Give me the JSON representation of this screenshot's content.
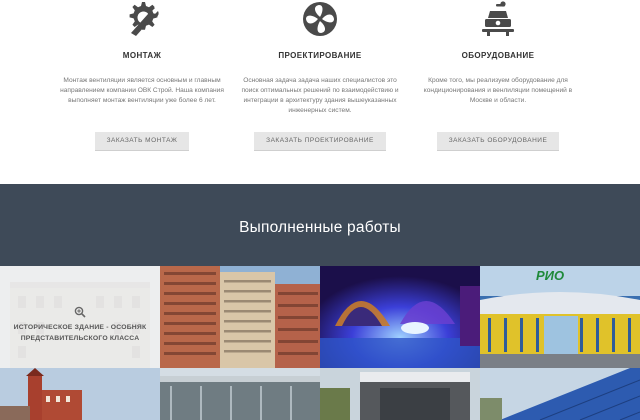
{
  "services": [
    {
      "icon": "wrench-gear-icon",
      "title": "МОНТАЖ",
      "description": "Монтаж вентиляции является основным и главным направлением компании ОВК Строй. Наша компания выполняет монтаж вентиляции уже более 6 лет.",
      "button": "ЗАКАЗАТЬ МОНТАЖ"
    },
    {
      "icon": "fan-icon",
      "title": "ПРОЕКТИРОВАНИЕ",
      "description": "Основная задача задача наших специалистов это поиск оптимальных решений по взаимодействию и интеграции в архитектуру здания вышеуказанных инженерных систем.",
      "button": "ЗАКАЗАТЬ ПРОЕКТИРОВАНИЕ"
    },
    {
      "icon": "projector-equipment-icon",
      "title": "ОБОРУДОВАНИЕ",
      "description": "Кроме того, мы реализуем оборудование для кондиционирования и венлиляции помещений в Москве и области.",
      "button": "ЗАКАЗАТЬ ОБОРУДОВАНИЕ"
    }
  ],
  "works": {
    "heading": "Выполненные работы",
    "hover_caption": "ИСТОРИЧЕСКОЕ ЗДАНИЕ - ОСОБНЯК ПРЕДСТАВИТЕЛЬСКОГО КЛАССА",
    "hover_icon": "zoom-icon",
    "mall_sign": "РИО"
  },
  "colors": {
    "band": "#3e4a58",
    "icon": "#4a4a4a",
    "button_bg": "#e6e6e6"
  }
}
